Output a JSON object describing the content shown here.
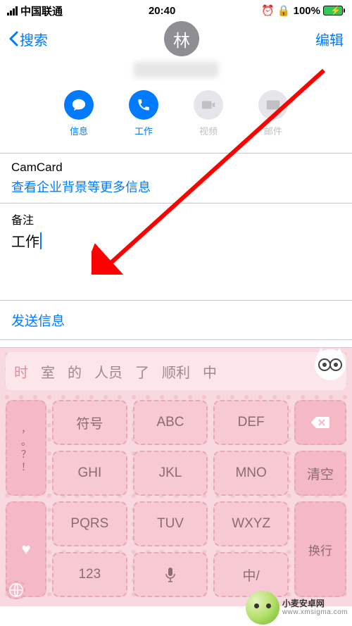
{
  "status": {
    "carrier": "中国联通",
    "time": "20:40",
    "battery": "100%"
  },
  "nav": {
    "back": "搜索",
    "avatar_letter": "林",
    "edit": "编辑"
  },
  "actions": {
    "message": "信息",
    "call": "工作",
    "video": "视频",
    "mail": "邮件"
  },
  "camcard": {
    "title": "CamCard",
    "link": "查看企业背景等更多信息"
  },
  "notes": {
    "label": "备注",
    "value": "工作"
  },
  "send": {
    "label": "发送信息"
  },
  "candidates": [
    "时",
    "室",
    "的",
    "人员",
    "了",
    "顺利",
    "中"
  ],
  "keys": {
    "punct": ", ， 。 ？ !",
    "symbols": "符号",
    "abc": "ABC",
    "def": "DEF",
    "ghi": "GHI",
    "jkl": "JKL",
    "mno": "MNO",
    "clear": "清空",
    "pqrs": "PQRS",
    "tuv": "TUV",
    "wxyz": "WXYZ",
    "enter": "换行",
    "num": "123",
    "lang": "中/"
  },
  "watermark": {
    "name": "小麦安卓网",
    "url": "www.xmsigma.com"
  }
}
